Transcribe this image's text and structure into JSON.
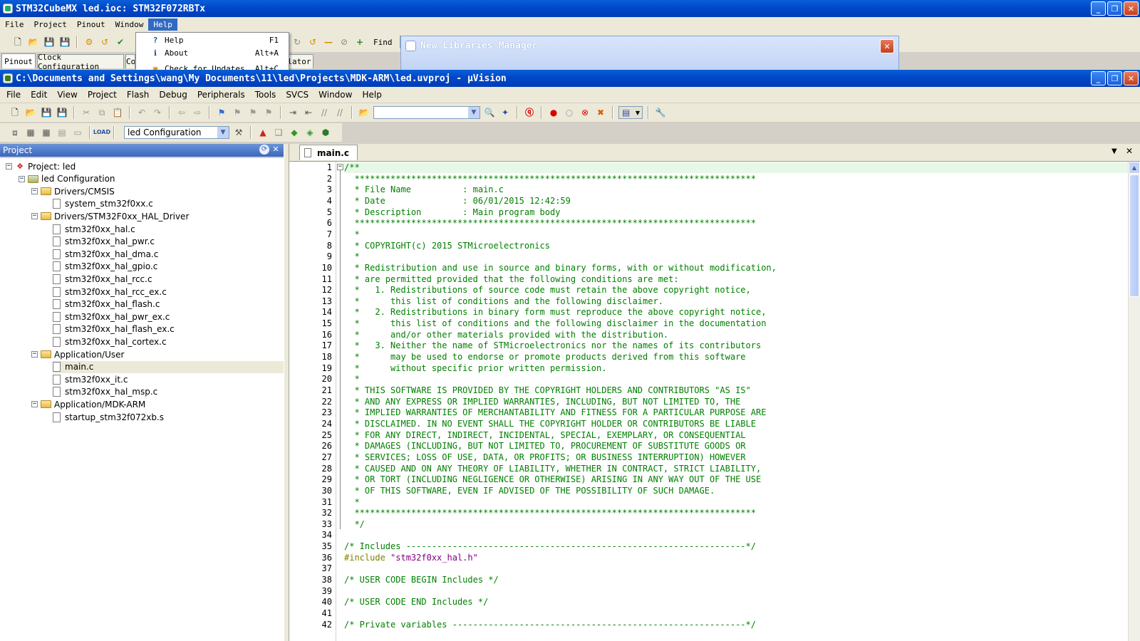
{
  "cube": {
    "title": "STM32CubeMX led.ioc: STM32F072RBTx",
    "menu": [
      "File",
      "Project",
      "Pinout",
      "Window",
      "Help"
    ],
    "tabs": [
      "Pinout",
      "Clock Configuration",
      "Co",
      "lator"
    ],
    "find_label": "Find",
    "help_menu": [
      {
        "label": "Help",
        "shortcut": "F1",
        "icon": "help-icon"
      },
      {
        "label": "About",
        "shortcut": "Alt+A",
        "icon": "info-icon"
      },
      {
        "label": "Check for Updates",
        "shortcut": "Alt+C",
        "icon": "update-icon"
      }
    ],
    "lib_manager_title": "New Libraries Manager"
  },
  "uv": {
    "title": "C:\\Documents and Settings\\wang\\My Documents\\11\\led\\Projects\\MDK-ARM\\led.uvproj - µVision",
    "menu": [
      "File",
      "Edit",
      "View",
      "Project",
      "Flash",
      "Debug",
      "Peripherals",
      "Tools",
      "SVCS",
      "Window",
      "Help"
    ],
    "target": "led Configuration",
    "panel_title": "Project",
    "tab_label": "main.c",
    "tree": [
      {
        "label": "Project: led",
        "level": 0,
        "kind": "project",
        "expander": "minus"
      },
      {
        "label": "led Configuration",
        "level": 1,
        "kind": "target",
        "expander": "minus"
      },
      {
        "label": "Drivers/CMSIS",
        "level": 2,
        "kind": "folder",
        "expander": "minus"
      },
      {
        "label": "system_stm32f0xx.c",
        "level": 3,
        "kind": "file"
      },
      {
        "label": "Drivers/STM32F0xx_HAL_Driver",
        "level": 2,
        "kind": "folder",
        "expander": "minus"
      },
      {
        "label": "stm32f0xx_hal.c",
        "level": 3,
        "kind": "file"
      },
      {
        "label": "stm32f0xx_hal_pwr.c",
        "level": 3,
        "kind": "file"
      },
      {
        "label": "stm32f0xx_hal_dma.c",
        "level": 3,
        "kind": "file"
      },
      {
        "label": "stm32f0xx_hal_gpio.c",
        "level": 3,
        "kind": "file"
      },
      {
        "label": "stm32f0xx_hal_rcc.c",
        "level": 3,
        "kind": "file"
      },
      {
        "label": "stm32f0xx_hal_rcc_ex.c",
        "level": 3,
        "kind": "file"
      },
      {
        "label": "stm32f0xx_hal_flash.c",
        "level": 3,
        "kind": "file"
      },
      {
        "label": "stm32f0xx_hal_pwr_ex.c",
        "level": 3,
        "kind": "file"
      },
      {
        "label": "stm32f0xx_hal_flash_ex.c",
        "level": 3,
        "kind": "file"
      },
      {
        "label": "stm32f0xx_hal_cortex.c",
        "level": 3,
        "kind": "file"
      },
      {
        "label": "Application/User",
        "level": 2,
        "kind": "folder",
        "expander": "minus"
      },
      {
        "label": "main.c",
        "level": 3,
        "kind": "file",
        "selected": true
      },
      {
        "label": "stm32f0xx_it.c",
        "level": 3,
        "kind": "file"
      },
      {
        "label": "stm32f0xx_hal_msp.c",
        "level": 3,
        "kind": "file"
      },
      {
        "label": "Application/MDK-ARM",
        "level": 2,
        "kind": "folder",
        "expander": "minus"
      },
      {
        "label": "startup_stm32f072xb.s",
        "level": 3,
        "kind": "file"
      }
    ],
    "code_lines": [
      {
        "n": "1",
        "segs": [
          {
            "t": "/**",
            "c": "cmt"
          }
        ]
      },
      {
        "n": "2",
        "segs": [
          {
            "t": "  ******************************************************************************",
            "c": "cmt"
          }
        ]
      },
      {
        "n": "3",
        "segs": [
          {
            "t": "  * File Name          : main.c",
            "c": "cmt"
          }
        ]
      },
      {
        "n": "4",
        "segs": [
          {
            "t": "  * Date               : 06/01/2015 12:42:59",
            "c": "cmt"
          }
        ]
      },
      {
        "n": "5",
        "segs": [
          {
            "t": "  * Description        : Main program body",
            "c": "cmt"
          }
        ]
      },
      {
        "n": "6",
        "segs": [
          {
            "t": "  ******************************************************************************",
            "c": "cmt"
          }
        ]
      },
      {
        "n": "7",
        "segs": [
          {
            "t": "  *",
            "c": "cmt"
          }
        ]
      },
      {
        "n": "8",
        "segs": [
          {
            "t": "  * COPYRIGHT(c) 2015 STMicroelectronics",
            "c": "cmt"
          }
        ]
      },
      {
        "n": "9",
        "segs": [
          {
            "t": "  *",
            "c": "cmt"
          }
        ]
      },
      {
        "n": "10",
        "segs": [
          {
            "t": "  * Redistribution and use in source and binary forms, with or without modification,",
            "c": "cmt"
          }
        ]
      },
      {
        "n": "11",
        "segs": [
          {
            "t": "  * are permitted provided that the following conditions are met:",
            "c": "cmt"
          }
        ]
      },
      {
        "n": "12",
        "segs": [
          {
            "t": "  *   1. Redistributions of source code must retain the above copyright notice,",
            "c": "cmt"
          }
        ]
      },
      {
        "n": "13",
        "segs": [
          {
            "t": "  *      this list of conditions and the following disclaimer.",
            "c": "cmt"
          }
        ]
      },
      {
        "n": "14",
        "segs": [
          {
            "t": "  *   2. Redistributions in binary form must reproduce the above copyright notice,",
            "c": "cmt"
          }
        ]
      },
      {
        "n": "15",
        "segs": [
          {
            "t": "  *      this list of conditions and the following disclaimer in the documentation",
            "c": "cmt"
          }
        ]
      },
      {
        "n": "16",
        "segs": [
          {
            "t": "  *      and/or other materials provided with the distribution.",
            "c": "cmt"
          }
        ]
      },
      {
        "n": "17",
        "segs": [
          {
            "t": "  *   3. Neither the name of STMicroelectronics nor the names of its contributors",
            "c": "cmt"
          }
        ]
      },
      {
        "n": "18",
        "segs": [
          {
            "t": "  *      may be used to endorse or promote products derived from this software",
            "c": "cmt"
          }
        ]
      },
      {
        "n": "19",
        "segs": [
          {
            "t": "  *      without specific prior written permission.",
            "c": "cmt"
          }
        ]
      },
      {
        "n": "20",
        "segs": [
          {
            "t": "  *",
            "c": "cmt"
          }
        ]
      },
      {
        "n": "21",
        "segs": [
          {
            "t": "  * THIS SOFTWARE IS PROVIDED BY THE COPYRIGHT HOLDERS AND CONTRIBUTORS \"AS IS\"",
            "c": "cmt"
          }
        ]
      },
      {
        "n": "22",
        "segs": [
          {
            "t": "  * AND ANY EXPRESS OR IMPLIED WARRANTIES, INCLUDING, BUT NOT LIMITED TO, THE",
            "c": "cmt"
          }
        ]
      },
      {
        "n": "23",
        "segs": [
          {
            "t": "  * IMPLIED WARRANTIES OF MERCHANTABILITY AND FITNESS FOR A PARTICULAR PURPOSE ARE",
            "c": "cmt"
          }
        ]
      },
      {
        "n": "24",
        "segs": [
          {
            "t": "  * DISCLAIMED. IN NO EVENT SHALL THE COPYRIGHT HOLDER OR CONTRIBUTORS BE LIABLE",
            "c": "cmt"
          }
        ]
      },
      {
        "n": "25",
        "segs": [
          {
            "t": "  * FOR ANY DIRECT, INDIRECT, INCIDENTAL, SPECIAL, EXEMPLARY, OR CONSEQUENTIAL",
            "c": "cmt"
          }
        ]
      },
      {
        "n": "26",
        "segs": [
          {
            "t": "  * DAMAGES (INCLUDING, BUT NOT LIMITED TO, PROCUREMENT OF SUBSTITUTE GOODS OR",
            "c": "cmt"
          }
        ]
      },
      {
        "n": "27",
        "segs": [
          {
            "t": "  * SERVICES; LOSS OF USE, DATA, OR PROFITS; OR BUSINESS INTERRUPTION) HOWEVER",
            "c": "cmt"
          }
        ]
      },
      {
        "n": "28",
        "segs": [
          {
            "t": "  * CAUSED AND ON ANY THEORY OF LIABILITY, WHETHER IN CONTRACT, STRICT LIABILITY,",
            "c": "cmt"
          }
        ]
      },
      {
        "n": "29",
        "segs": [
          {
            "t": "  * OR TORT (INCLUDING NEGLIGENCE OR OTHERWISE) ARISING IN ANY WAY OUT OF THE USE",
            "c": "cmt"
          }
        ]
      },
      {
        "n": "30",
        "segs": [
          {
            "t": "  * OF THIS SOFTWARE, EVEN IF ADVISED OF THE POSSIBILITY OF SUCH DAMAGE.",
            "c": "cmt"
          }
        ]
      },
      {
        "n": "31",
        "segs": [
          {
            "t": "  *",
            "c": "cmt"
          }
        ]
      },
      {
        "n": "32",
        "segs": [
          {
            "t": "  ******************************************************************************",
            "c": "cmt"
          }
        ]
      },
      {
        "n": "33",
        "segs": [
          {
            "t": "  */",
            "c": "cmt"
          }
        ]
      },
      {
        "n": "34",
        "segs": []
      },
      {
        "n": "35",
        "segs": [
          {
            "t": "/* Includes ------------------------------------------------------------------*/",
            "c": "cmt"
          }
        ]
      },
      {
        "n": "36",
        "segs": [
          {
            "t": "#include ",
            "c": "pp"
          },
          {
            "t": "\"stm32f0xx_hal.h\"",
            "c": "str"
          }
        ]
      },
      {
        "n": "37",
        "segs": []
      },
      {
        "n": "38",
        "segs": [
          {
            "t": "/* USER CODE BEGIN Includes */",
            "c": "cmt"
          }
        ]
      },
      {
        "n": "39",
        "segs": []
      },
      {
        "n": "40",
        "segs": [
          {
            "t": "/* USER CODE END Includes */",
            "c": "cmt"
          }
        ]
      },
      {
        "n": "41",
        "segs": []
      },
      {
        "n": "42",
        "segs": [
          {
            "t": "/* Private variables ---------------------------------------------------------*/",
            "c": "cmt"
          }
        ]
      }
    ]
  },
  "colors": {
    "titlebar": "#0048c8",
    "comment": "#008000",
    "preprocessor": "#808000",
    "string": "#800080",
    "selected_row": "#ece9d8"
  }
}
